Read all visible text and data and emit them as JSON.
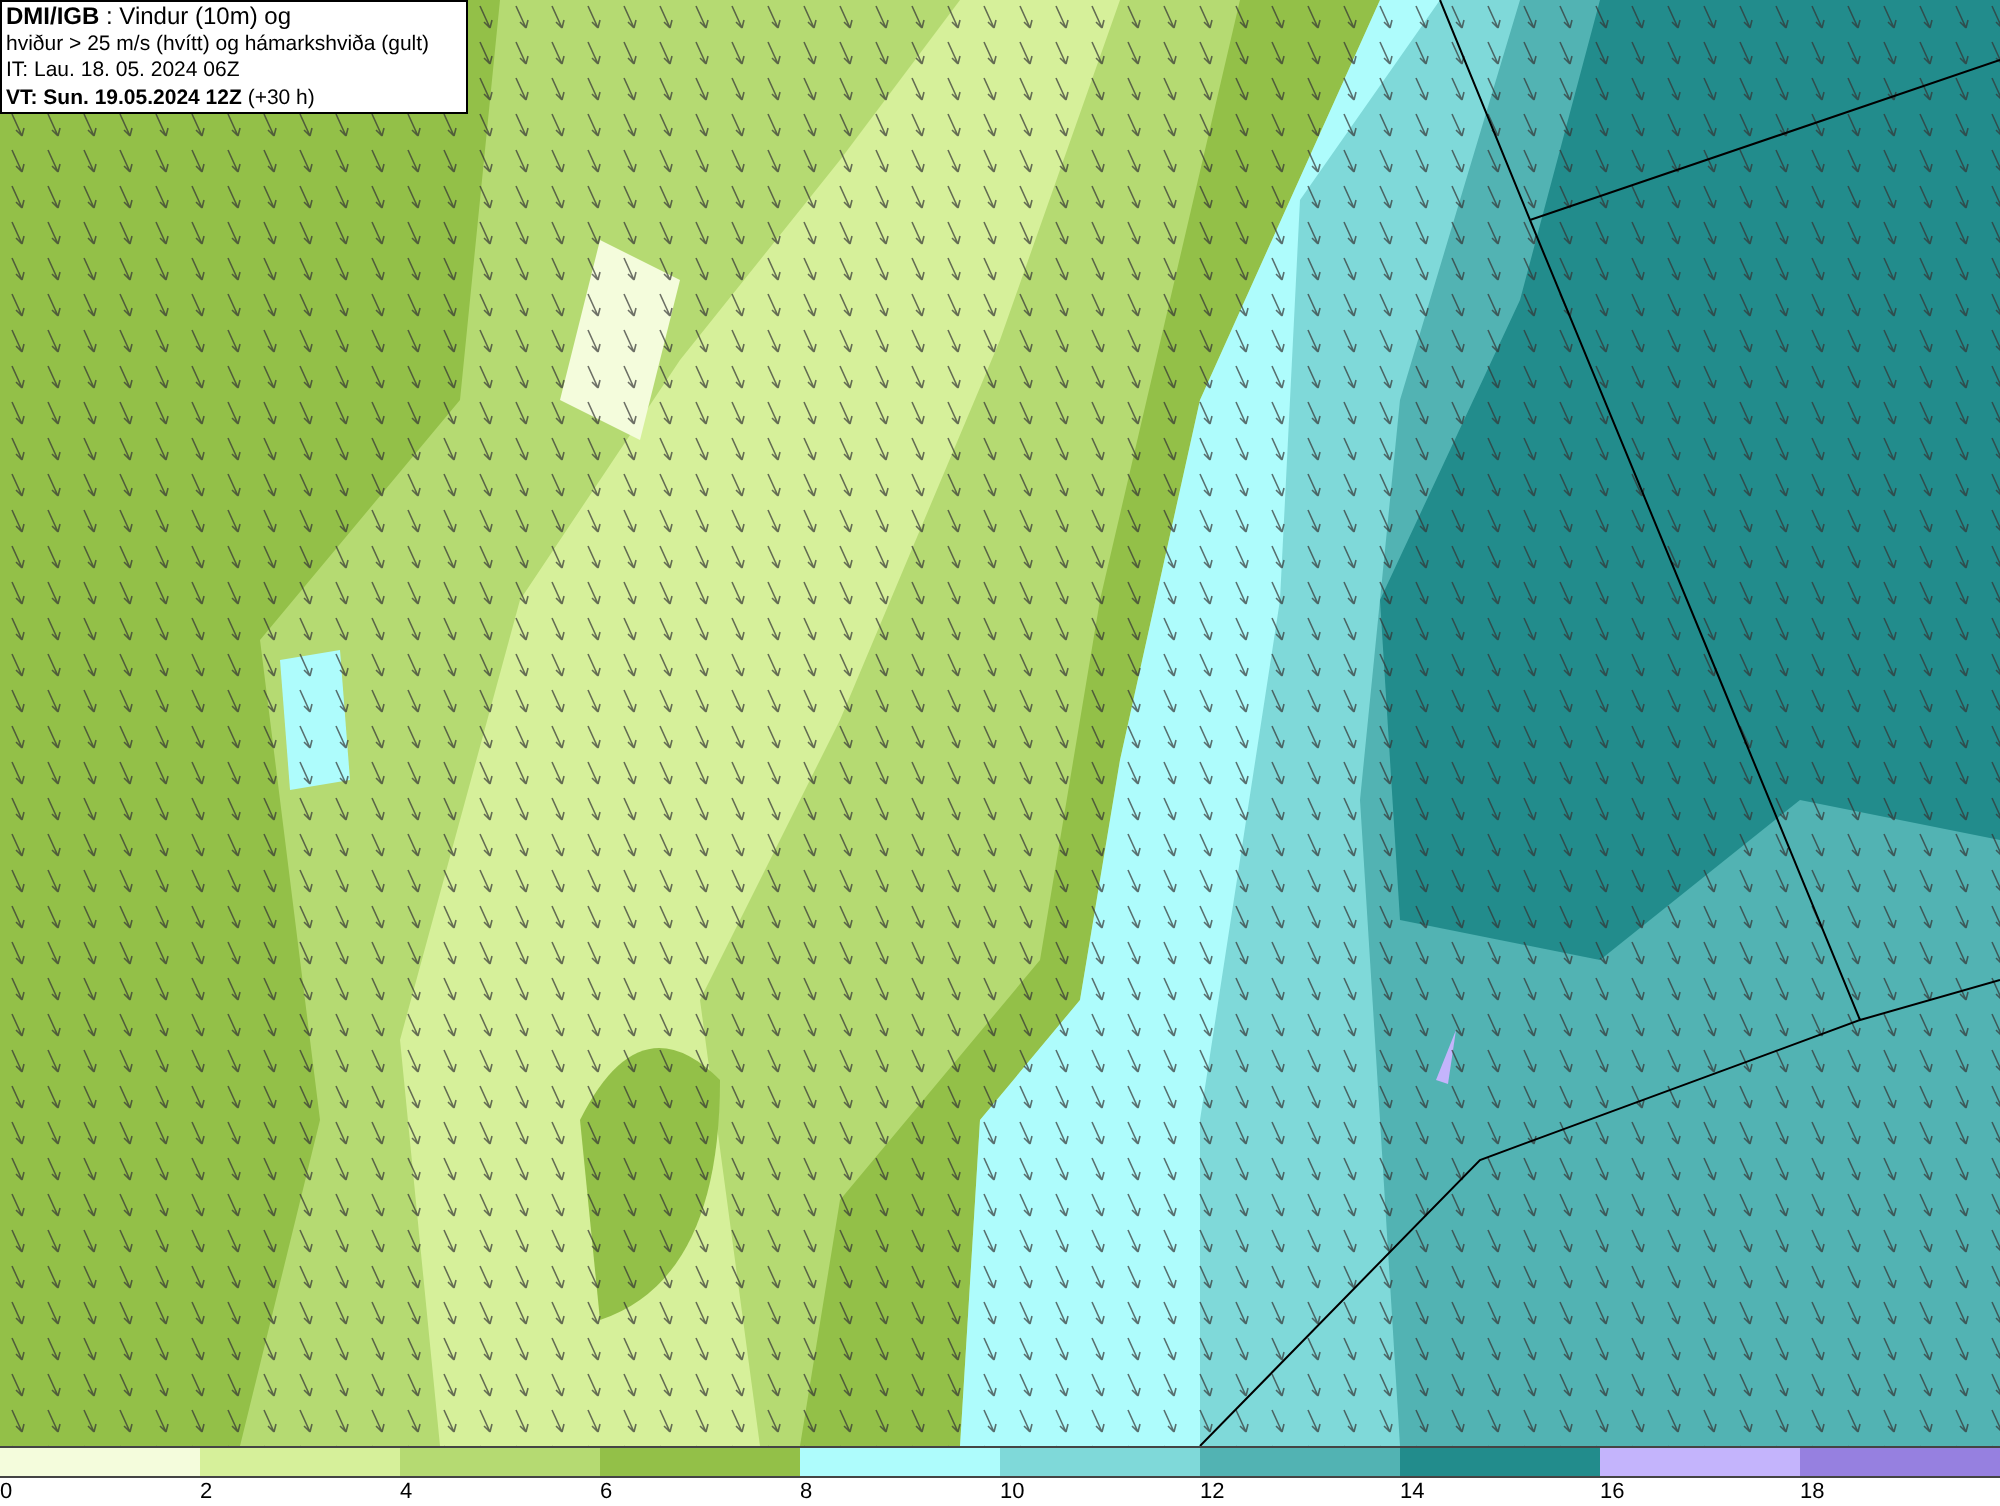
{
  "header": {
    "lines": [
      "**DMI/IGB** : Vindur (10m) og",
      "hviður > 25 m/s (hvítt) og hámarkshviða (gult)",
      "IT: Lau. 18. 05. 2024 06Z",
      "**VT: Sun. 19.05.2024 12Z** (+30 h)"
    ]
  },
  "legend": [
    {
      "label": "0",
      "color": "#f4fcdc"
    },
    {
      "label": "2",
      "color": "#d6f09a"
    },
    {
      "label": "4",
      "color": "#b5da72"
    },
    {
      "label": "6",
      "color": "#93c048"
    },
    {
      "label": "8",
      "color": "#aefcfc"
    },
    {
      "label": "10",
      "color": "#7fd9d9"
    },
    {
      "label": "12",
      "color": "#52b3b3"
    },
    {
      "label": "14",
      "color": "#228c8c"
    },
    {
      "label": "16",
      "color": "#c4b4fc"
    },
    {
      "label": "18",
      "color": "#9680e0"
    }
  ]
}
